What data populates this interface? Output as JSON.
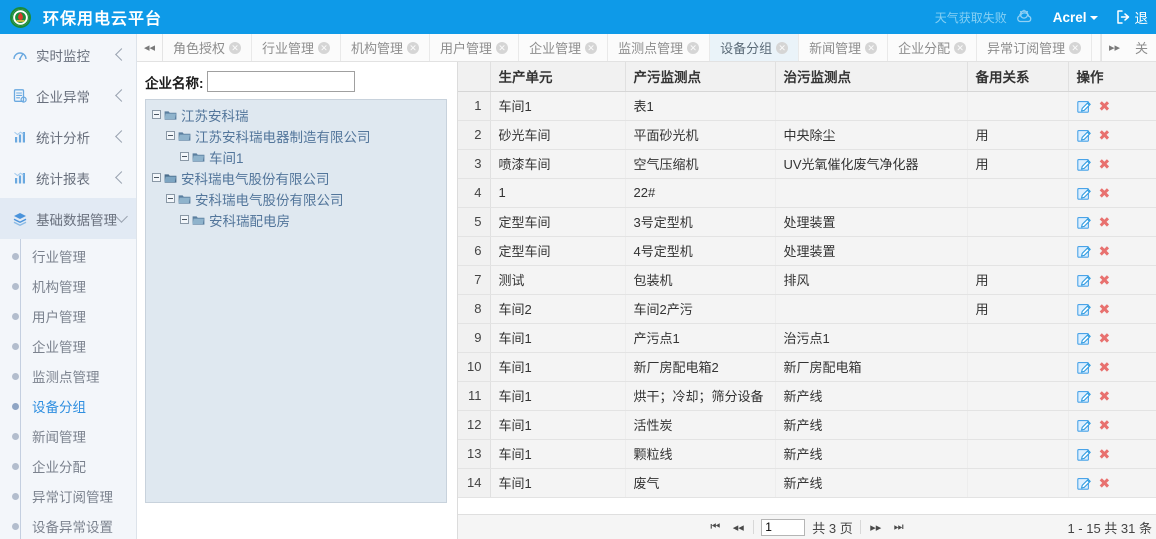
{
  "header": {
    "title": "环保用电云平台",
    "logo_icon": "circular-green-emblem-logo",
    "weather_status": "天气获取失败",
    "weather_icon": "cloud-weather-icon",
    "user_name": "Acrel",
    "user_caret_icon": "caret-down-icon",
    "logout_icon": "logout-icon",
    "logout_label": "退",
    "bg_color": "#0e9ae8"
  },
  "sidebar": {
    "items": [
      {
        "label": "实时监控",
        "icon": "gauge-icon",
        "chevron": "chevron-left-icon",
        "open": false
      },
      {
        "label": "企业异常",
        "icon": "document-alert-icon",
        "chevron": "chevron-left-icon",
        "open": false
      },
      {
        "label": "统计分析",
        "icon": "bar-chart-icon",
        "chevron": "chevron-left-icon",
        "open": false
      },
      {
        "label": "统计报表",
        "icon": "bar-chart-icon",
        "chevron": "chevron-left-icon",
        "open": false
      },
      {
        "label": "基础数据管理",
        "icon": "layers-icon",
        "chevron": "chevron-down-icon",
        "open": true
      }
    ],
    "submenu": [
      {
        "label": "行业管理",
        "active": false
      },
      {
        "label": "机构管理",
        "active": false
      },
      {
        "label": "用户管理",
        "active": false
      },
      {
        "label": "企业管理",
        "active": false
      },
      {
        "label": "监测点管理",
        "active": false
      },
      {
        "label": "设备分组",
        "active": true
      },
      {
        "label": "新闻管理",
        "active": false
      },
      {
        "label": "企业分配",
        "active": false
      },
      {
        "label": "异常订阅管理",
        "active": false
      },
      {
        "label": "设备异常设置",
        "active": false
      }
    ],
    "active_color": "#2f8fe0"
  },
  "tabs": {
    "scroll_left_icon": "double-chevron-left-icon",
    "scroll_right_icon": "double-chevron-right-icon",
    "close_all_label": "关",
    "close_icon": "close-circle-icon",
    "items": [
      {
        "label": "角色授权",
        "active": false
      },
      {
        "label": "行业管理",
        "active": false
      },
      {
        "label": "机构管理",
        "active": false
      },
      {
        "label": "用户管理",
        "active": false
      },
      {
        "label": "企业管理",
        "active": false
      },
      {
        "label": "监测点管理",
        "active": false
      },
      {
        "label": "设备分组",
        "active": true
      },
      {
        "label": "新闻管理",
        "active": false
      },
      {
        "label": "企业分配",
        "active": false
      },
      {
        "label": "异常订阅管理",
        "active": false
      }
    ]
  },
  "tree_panel": {
    "search_label": "企业名称:",
    "search_value": "",
    "search_placeholder": "",
    "folder_icon": "folder-icon",
    "toggle_icon": "collapse-box-icon",
    "nodes": [
      {
        "label": "江苏安科瑞",
        "depth": 0
      },
      {
        "label": "江苏安科瑞电器制造有限公司",
        "depth": 1
      },
      {
        "label": "车间1",
        "depth": 2
      },
      {
        "label": "安科瑞电气股份有限公司",
        "depth": 0
      },
      {
        "label": "安科瑞电气股份有限公司",
        "depth": 1
      },
      {
        "label": "安科瑞配电房",
        "depth": 2
      }
    ]
  },
  "table": {
    "columns": [
      "",
      "生产单元",
      "产污监测点",
      "治污监测点",
      "备用关系",
      "操作"
    ],
    "edit_icon": "edit-icon",
    "delete_icon": "delete-x-icon",
    "rows": [
      {
        "num": "1",
        "unit": "车间1",
        "prod": "表1",
        "treat": "",
        "spare": ""
      },
      {
        "num": "2",
        "unit": "砂光车间",
        "prod": "平面砂光机",
        "treat": "中央除尘",
        "spare": "用"
      },
      {
        "num": "3",
        "unit": "喷漆车间",
        "prod": "空气压缩机",
        "treat": "UV光氧催化废气净化器",
        "spare": "用"
      },
      {
        "num": "4",
        "unit": "1",
        "prod": "22#",
        "treat": "",
        "spare": ""
      },
      {
        "num": "5",
        "unit": "定型车间",
        "prod": "3号定型机",
        "treat": "处理装置",
        "spare": ""
      },
      {
        "num": "6",
        "unit": "定型车间",
        "prod": "4号定型机",
        "treat": "处理装置",
        "spare": ""
      },
      {
        "num": "7",
        "unit": "测试",
        "prod": "包装机",
        "treat": "排风",
        "spare": "用"
      },
      {
        "num": "8",
        "unit": "车间2",
        "prod": "车间2产污",
        "treat": "",
        "spare": "用"
      },
      {
        "num": "9",
        "unit": "车间1",
        "prod": "产污点1",
        "treat": "治污点1",
        "spare": ""
      },
      {
        "num": "10",
        "unit": "车间1",
        "prod": "新厂房配电箱2",
        "treat": "新厂房配电箱",
        "spare": ""
      },
      {
        "num": "11",
        "unit": "车间1",
        "prod": "烘干；冷却；筛分设备",
        "treat": "新产线",
        "spare": ""
      },
      {
        "num": "12",
        "unit": "车间1",
        "prod": "活性炭",
        "treat": "新产线",
        "spare": ""
      },
      {
        "num": "13",
        "unit": "车间1",
        "prod": "颗粒线",
        "treat": "新产线",
        "spare": ""
      },
      {
        "num": "14",
        "unit": "车间1",
        "prod": "废气",
        "treat": "新产线",
        "spare": ""
      }
    ]
  },
  "pager": {
    "first_icon": "page-first-icon",
    "prev_icon": "page-prev-icon",
    "next_icon": "page-next-icon",
    "last_icon": "page-last-icon",
    "page_value": "1",
    "total_pages_label": "共 3 页",
    "range_label": "1 - 15  共 31 条"
  }
}
